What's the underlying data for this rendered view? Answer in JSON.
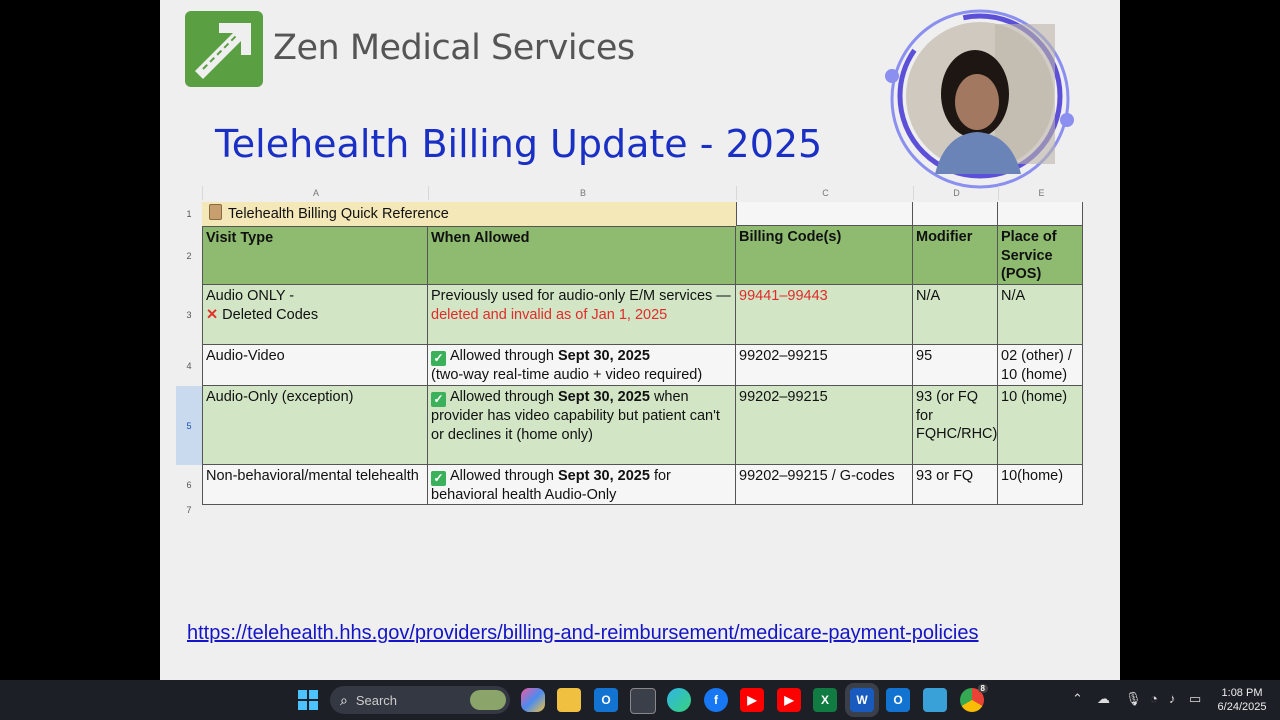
{
  "slide": {
    "company": "Zen Medical Services",
    "title": "Telehealth Billing Update - 2025",
    "link": "https://telehealth.hhs.gov/providers/billing-and-reimbursement/medicare-payment-policies"
  },
  "sheet": {
    "columns": [
      "A",
      "B",
      "C",
      "D",
      "E"
    ],
    "rows": [
      "1",
      "2",
      "3",
      "4",
      "5",
      "6",
      "7"
    ],
    "title_icon": "clipboard-icon",
    "title": "Telehealth Billing Quick Reference",
    "headers": [
      "Visit Type",
      "When Allowed",
      "Billing Code(s)",
      "Modifier",
      "Place of Service (POS)"
    ],
    "r3": {
      "a1": "Audio ONLY -",
      "a2": "Deleted Codes",
      "b1": "Previously used for audio-only E/M services — ",
      "b2": "deleted and invalid as of Jan 1, 2025",
      "c": "99441–99443",
      "d": "N/A",
      "e": "N/A"
    },
    "r4": {
      "a": "Audio-Video",
      "b1": "Allowed through ",
      "b2": "Sept 30, 2025",
      "b3": "(two-way real-time audio + video required)",
      "c": "99202–99215",
      "d": "95",
      "e": "02 (other) / 10 (home)"
    },
    "r5": {
      "a": "Audio-Only (exception)",
      "b1": "Allowed through ",
      "b2": "Sept 30, 2025",
      "b3": " when provider has video capability but patient can't or declines it (home only)",
      "c": "99202–99215",
      "d": "93 (or FQ for FQHC/RHC)",
      "e": "10 (home)"
    },
    "r6": {
      "a": "Non-behavioral/mental telehealth",
      "b1": "Allowed through ",
      "b2": "Sept 30, 2025",
      "b3": " for behavioral health Audio-Only",
      "c": "99202–99215 / G-codes",
      "d": "93 or FQ",
      "e": "10(home)"
    }
  },
  "taskbar": {
    "search_placeholder": "Search",
    "time": "1:08 PM",
    "date": "6/24/2025",
    "chrome_badge": "8"
  },
  "colors": {
    "title_blue": "#1a2fc4",
    "header_green": "#8fbb70",
    "row_green": "#d2e6c6",
    "deleted_red": "#e02b2b",
    "logo_green": "#5aa043"
  }
}
